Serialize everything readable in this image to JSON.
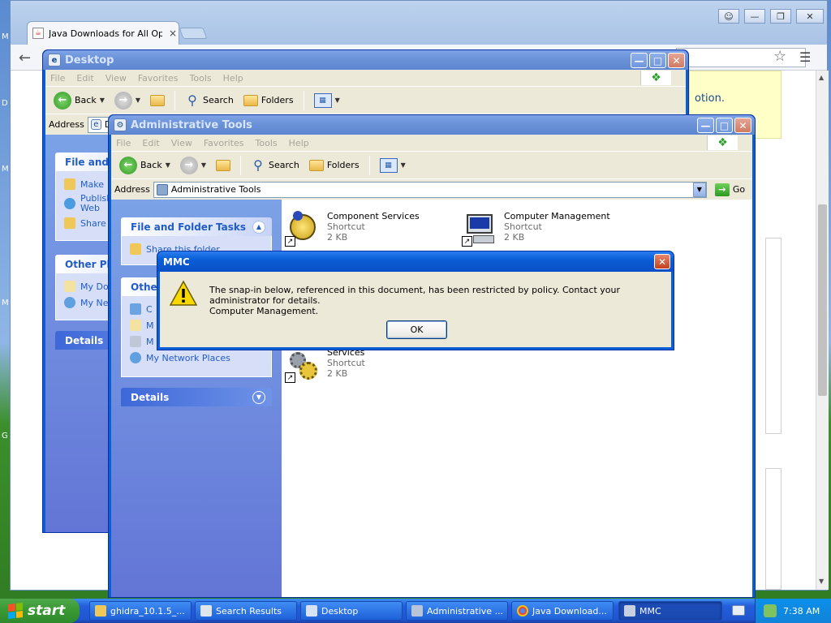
{
  "chrome": {
    "tab_title": "Java Downloads for All Oper",
    "tab_close": "×",
    "banner_text": "otion."
  },
  "desktop_window": {
    "title": "Desktop",
    "menu": [
      "File",
      "Edit",
      "View",
      "Favorites",
      "Tools",
      "Help"
    ],
    "back_label": "Back",
    "search_label": "Search",
    "folders_label": "Folders",
    "address_label": "Address",
    "address_value": "D",
    "panels": {
      "file_tasks_title": "File and F",
      "file_tasks_items": [
        "Make",
        "Publish Web",
        "Share"
      ],
      "other_places_title": "Other Pla",
      "other_places_items": [
        "My Do",
        "My Ne"
      ],
      "details_title": "Details"
    }
  },
  "admin_window": {
    "title": "Administrative Tools",
    "menu": [
      "File",
      "Edit",
      "View",
      "Favorites",
      "Tools",
      "Help"
    ],
    "back_label": "Back",
    "search_label": "Search",
    "folders_label": "Folders",
    "address_label": "Address",
    "address_value": "Administrative Tools",
    "go_label": "Go",
    "panels": {
      "file_tasks_title": "File and Folder Tasks",
      "share_item": "Share this folder",
      "other_places_title": "Other",
      "other_items": [
        "C",
        "M",
        "M"
      ],
      "network_places": "My Network Places",
      "details_title": "Details"
    },
    "files": [
      {
        "name": "Component Services",
        "type": "Shortcut",
        "size": "2 KB"
      },
      {
        "name": "Computer Management",
        "type": "Shortcut",
        "size": "2 KB"
      },
      {
        "name": "Services",
        "type": "Shortcut",
        "size": "2 KB"
      }
    ]
  },
  "dialog": {
    "title": "MMC",
    "message_line1": "The snap-in below, referenced in this document, has been restricted by policy. Contact your administrator for details.",
    "message_line2": "Computer Management.",
    "ok_label": "OK"
  },
  "taskbar": {
    "start_label": "start",
    "tasks": [
      {
        "label": "ghidra_10.1.5_..."
      },
      {
        "label": "Search Results"
      },
      {
        "label": "Desktop"
      },
      {
        "label": "Administrative ..."
      },
      {
        "label": "Java Download..."
      },
      {
        "label": "MMC"
      }
    ],
    "clock": "7:38 AM"
  },
  "colors": {
    "xp_blue": "#0a5ed6",
    "start_green": "#3c9a36",
    "task_link": "#215dc6"
  }
}
